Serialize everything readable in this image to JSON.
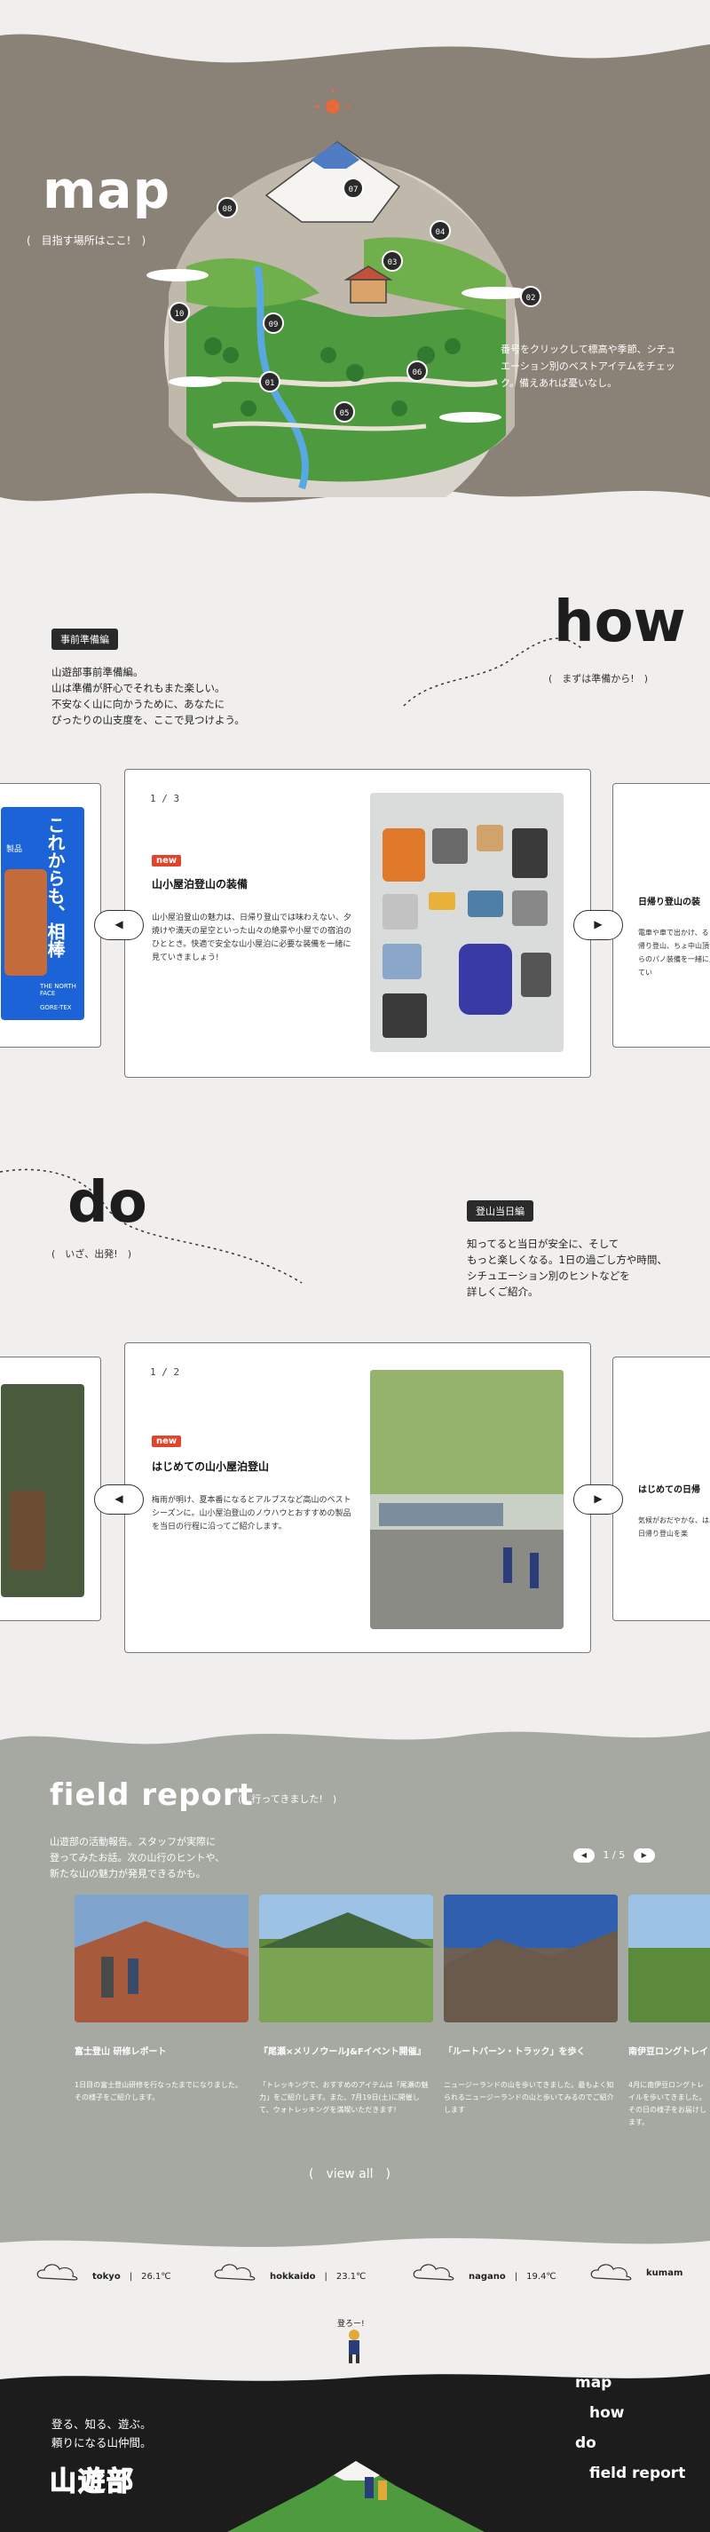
{
  "hero": {
    "title": "map",
    "subtitle": "(　目指す場所はここ!　)",
    "description": "番号をクリックして標高や季節、シチュエーション別のベストアイテムをチェック。備えあれば憂いなし。",
    "pins": [
      "01",
      "02",
      "03",
      "04",
      "05",
      "06",
      "07",
      "08",
      "09",
      "10"
    ]
  },
  "how": {
    "badge": "事前準備編",
    "text": "山遊部事前準備編。\n山は準備が肝心でそれもまた楽しい。\n不安なく山に向かうために、あなたに\nぴったりの山支度を、ここで見つけよう。",
    "word": "how",
    "sub": "(　まずは準備から!　)",
    "side_left_text": "これからも、相棒",
    "side_left_tag": "THE NORTH FACE",
    "side_left_small": "GORE-TEX",
    "side_left_small2": "製品",
    "card": {
      "page": "1 / 3",
      "tag": "new",
      "title": "山小屋泊登山の装備",
      "body": "山小屋泊登山の魅力は、日帰り登山では味わえない、夕焼けや満天の星空といった山々の絶景や小屋での宿泊のひととき。快適で安全な山小屋泊に必要な装備を一緒に見ていきましょう!"
    },
    "side_right": {
      "title": "日帰り登山の装",
      "body": "電車や車で出かけ、る日帰り登山、ちょ中山頂からのパノ装備を一緒に見てい"
    },
    "prev": "◀",
    "next": "▶"
  },
  "do": {
    "word": "do",
    "sub": "(　いざ、出発!　)",
    "badge": "登山当日編",
    "text": "知ってると当日が安全に、そして\nもっと楽しくなる。1日の過ごし方や時間、\nシチュエーション別のヒントなどを\n詳しくご紹介。",
    "card": {
      "page": "1 / 2",
      "tag": "new",
      "title": "はじめての山小屋泊登山",
      "body": "梅雨が明け、夏本番になるとアルプスなど高山のベストシーズンに。山小屋泊登山のノウハウとおすすめの製品を当日の行程に沿ってご紹介します。"
    },
    "side_right": {
      "title": "はじめての日帰",
      "body": "気候がおだやかな、は、日帰り登山を楽"
    },
    "prev": "◀",
    "next": "▶"
  },
  "field": {
    "title": "field report",
    "sub": "(　行ってきました!　)",
    "desc": "山遊部の活動報告。スタッフが実際に\n登ってみたお話。次の山行のヒントや、\n新たな山の魅力が発見できるかも。",
    "pager": "1 / 5",
    "pager_prev": "◀",
    "pager_next": "▶",
    "cards": [
      {
        "title": "富士登山 研修レポート",
        "body": "1日目の富士登山研修を行なったまでになりました。その様子をご紹介します。"
      },
      {
        "title": "『尾瀬×メリノウールJ&Fイベント開催』",
        "body": "「トレッキングで、おすすめのアイテムは「尾瀬の魅力」をご紹介します。また、7月19日(土)に開催して、ウォトレッキングを満喫いただきます!"
      },
      {
        "title": "「ルートバーン・トラック」を歩く",
        "body": "ニュージーランドの山を歩いてきました。最もよく知られるニュージーランドの山と歩いてみるのでご紹介します"
      },
      {
        "title": "南伊豆ロングトレイ",
        "body": "4月に南伊豆ロングトレイルを歩いてきました。その日の様子をお届けします。"
      }
    ],
    "view_all": "(　view all　)"
  },
  "weather": [
    {
      "place": "tokyo",
      "temp": "26.1℃"
    },
    {
      "place": "hokkaido",
      "temp": "23.1℃"
    },
    {
      "place": "nagano",
      "temp": "19.4℃"
    },
    {
      "place": "kumam",
      "temp": ""
    }
  ],
  "footer": {
    "mascot_text": "登ろー!",
    "copy": "登る、知る、遊ぶ。\n頼りになる山仲間。",
    "logo": "山遊部",
    "nav": [
      "map",
      "how",
      "do",
      "field report"
    ]
  },
  "colors": {
    "hero_bg": "#8a8177",
    "field_bg": "#a5a9a2",
    "footer_bg": "#1d1c1c",
    "accent": "#e0452b",
    "brand_blue": "#1b63d6"
  }
}
